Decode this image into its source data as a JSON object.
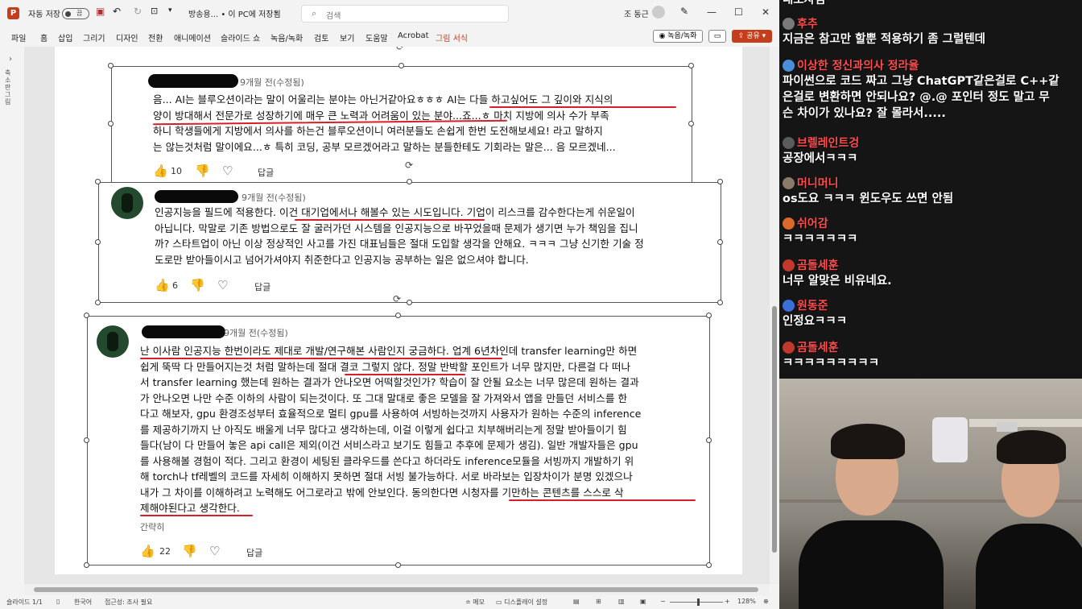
{
  "window": {
    "autosave_label": "자동 저장",
    "autosave_state": "끔",
    "filename": "방송용... • 이 PC에 저장됨",
    "search_placeholder": "검색",
    "user_name": "조 동근"
  },
  "menu": [
    "파일",
    "홈",
    "삽입",
    "그리기",
    "디자인",
    "전환",
    "애니메이션",
    "슬라이드 쇼",
    "녹음/녹화",
    "검토",
    "보기",
    "도움말",
    "Acrobat",
    "그림 서식"
  ],
  "ribbon_right": {
    "record": "◉ 녹음/녹화",
    "share": "공유"
  },
  "left_pane": {
    "label": "축소판 그림"
  },
  "comments": [
    {
      "time": "9개월 전(수정됨)",
      "lines": [
        "음... AI는 블루오션이라는 말이 어울리는 분야는 아닌거같아요ㅎㅎㅎ AI는 다들 하고싶어도 그 깊이와 지식의",
        "양이 방대해서 전문가로 성장하기에 매우 큰 노력과 어려움이 있는 분야...죠...ㅎ 마치 지방에 의사 수가 부족",
        "하니 학생들에게 지방에서 의사를 하는건 블루오션이니 여러분들도 손쉽게 한번 도전해보세요! 라고 말하지",
        "는 않는것처럼 말이에요...ㅎ 특히 코딩, 공부 모르겠어라고 말하는 분들한테도 기회라는 말은... 음 모르겠네..."
      ],
      "likes": "10",
      "reply": "답글"
    },
    {
      "time": "9개월 전(수정됨)",
      "lines": [
        "인공지능을 필드에 적용한다. 이건 대기업에서나 해볼수 있는 시도입니다. 기업이 리스크를 감수한다는게 쉬운일이",
        "아닙니다. 막말로 기존 방법으로도 잘 굴러가던 시스템을 인공지능으로 바꾸었을때 문제가 생기면 누가 책임을 집니",
        "까? 스타트업이 아닌 이상 정상적인 사고를 가진 대표님들은 절대 도입할 생각을 안해요. ㅋㅋㅋ 그냥 신기한 기술 정",
        "도로만 받아들이시고 넘어가셔야지 취준한다고 인공지능 공부하는 일은 없으셔야 합니다."
      ],
      "likes": "6",
      "reply": "답글"
    },
    {
      "time": "9개월 전(수정됨)",
      "lines": [
        "난 이사람 인공지능 한번이라도 제대로 개발/연구해본 사람인지 궁금하다. 업계 6년차인데 transfer learning만 하면",
        "쉽게 뚝딱 다 만들어지는것 처럼 말하는데 절대 결코 그렇지 않다. 정말 반박할 포인트가 너무 많지만, 다른걸 다 떠나",
        "서 transfer learning 했는데 원하는 결과가 안나오면 어떡할것인가? 학습이 잘 안될 요소는 너무 많은데 원하는 결과",
        "가 안나오면 나만 수준 이하의 사람이 되는것이다. 또 그대 말대로 좋은 모델을 잘 가져와서 앱을 만들던 서비스를 한",
        "다고 해보자, gpu 환경조성부터 효율적으로 멀티 gpu를 사용하여 서빙하는것까지 사용자가 원하는 수준의 inference",
        "를 제공하기까지 난 아직도 배울게 너무 많다고 생각하는데, 이걸 이렇게 쉽다고 치부해버리는게 정말 받아들이기 힘",
        "들다(남이 다 만들어 놓은 api call은 제외(이건 서비스라고 보기도 힘들고 추후에 문제가 생김). 일반 개발자들은 gpu",
        "를 사용해볼 경험이 적다. 그리고 환경이 세팅된 클라우드를 쓴다고 하더라도 inference모듈을 서빙까지 개발하기 위",
        "해 torch나 tf레벨의 코드를 자세히 이해하지 못하면 절대 서빙 불가능하다. 서로 바라보는 입장차이가 분명 있겠으나",
        "내가 그 차이를 이해하려고 노력해도 어그로라고 밖에 안보인다. 동의한다면 시청자를 기만하는 콘텐츠를 스스로 삭",
        "제해야된다고 생각한다."
      ],
      "collapse": "간략히",
      "likes": "22",
      "reply": "답글"
    }
  ],
  "statusbar": {
    "slide": "슬라이드 1/1",
    "language": "한국어",
    "accessibility": "접근성: 조사 필요",
    "notes": "메모",
    "display": "디스플레이 설정",
    "zoom": "128%"
  },
  "chat": [
    {
      "name": "",
      "text": [
        "내보자님"
      ],
      "badge": "#888888"
    },
    {
      "name": "후추",
      "text": [
        "지금은 참고만 할뿐 적용하기 좀 그럴텐데"
      ],
      "badge": "#7a7a7a"
    },
    {
      "name": "이상한 정신과의사 정라율",
      "text": [
        "파이썬으로 코드 짜고 그냥 ChatGPT같은걸로 C++같",
        "은걸로 변환하면 안되나요? @.@ 포인터 정도 말고 무",
        "슨 차이가 있나요? 잘 몰라서....."
      ],
      "badge": "#4a90d9"
    },
    {
      "name": "브렐레인트겅",
      "text": [
        "공장에서ㅋㅋㅋ"
      ],
      "badge": "#5b5b5b"
    },
    {
      "name": "머니머니",
      "text": [
        "os도요 ㅋㅋㅋ 윈도우도 쓰면 안됨"
      ],
      "badge": "#8a7a6a"
    },
    {
      "name": "쉬어감",
      "text": [
        "ㅋㅋㅋㅋㅋㅋㅋ"
      ],
      "badge": "#d96a2a"
    },
    {
      "name": "곰돌세훈",
      "text": [
        "너무 알맞은 비유네요."
      ],
      "badge": "#c0392b"
    },
    {
      "name": "원동준",
      "text": [
        "인정요ㅋㅋㅋ"
      ],
      "badge": "#3a6fd8"
    },
    {
      "name": "곰돌세훈",
      "text": [
        "ㅋㅋㅋㅋㅋㅋㅋㅋㅋ"
      ],
      "badge": "#c0392b"
    }
  ],
  "colors": {
    "accent": "#c43e1c",
    "underline": "#d4202b",
    "chat_name": "#ff4d4d"
  }
}
